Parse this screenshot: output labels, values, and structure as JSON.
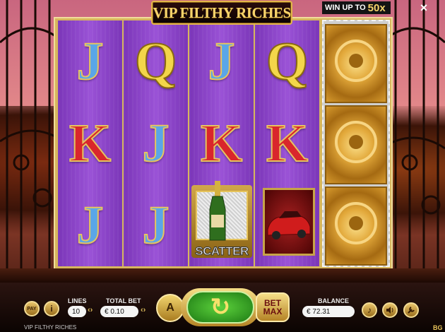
{
  "game": {
    "title": "VIP FILTHY RICHES",
    "win_up_prefix": "WIN UP TO",
    "win_up_value": "50x",
    "close_icon": "×"
  },
  "reels": [
    [
      "J",
      "K",
      "J"
    ],
    [
      "Q",
      "J",
      "J"
    ],
    [
      "J",
      "K",
      "SCATTER"
    ],
    [
      "Q",
      "K",
      "CAR"
    ]
  ],
  "scatter_label": "SCATTER",
  "vault_reel": {
    "count": 3,
    "icon": "vault-door-icon"
  },
  "controls": {
    "paytable_label": "PAY",
    "info_icon": "i",
    "lines_label": "LINES",
    "lines_value": "10",
    "total_bet_label": "TOTAL BET",
    "total_bet_value": "€ 0.10",
    "autoplay_label": "A",
    "spin_icon": "↻",
    "bet_max_label": "BET MAX",
    "balance_label": "BALANCE",
    "balance_value": "€ 72.31",
    "music_icon": "♪",
    "sound_icon": "speaker-icon",
    "settings_icon": "wrench-icon"
  },
  "footer": {
    "game_name": "VIP FILTHY RICHES",
    "provider": "BG"
  },
  "colors": {
    "reel_bg": "#8a45c8",
    "gold": "#e3b64a",
    "spin_green": "#2e9a1f"
  }
}
